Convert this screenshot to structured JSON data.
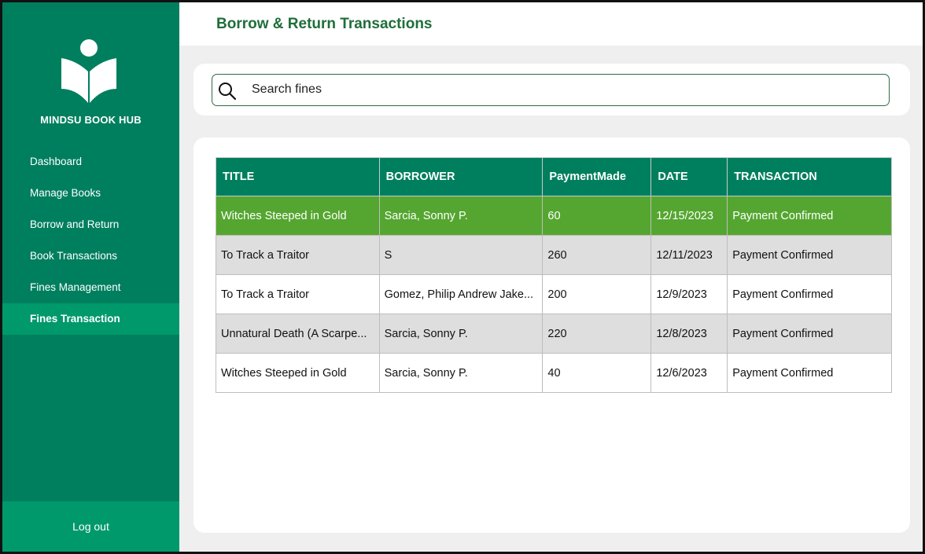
{
  "sidebar": {
    "brand": "MINDSU BOOK HUB",
    "logo_icon": "reading-book-icon",
    "items": [
      {
        "label": "Dashboard"
      },
      {
        "label": "Manage Books"
      },
      {
        "label": "Borrow and Return"
      },
      {
        "label": "Book Transactions"
      },
      {
        "label": "Fines Management"
      },
      {
        "label": "Fines Transaction"
      }
    ],
    "active_item": "Fines Transaction",
    "logout_label": "Log out"
  },
  "header": {
    "title": "Borrow & Return Transactions"
  },
  "search": {
    "placeholder": "Search fines",
    "value": "",
    "icon": "search-icon"
  },
  "table": {
    "columns": [
      "TITLE",
      "BORROWER",
      "PaymentMade",
      "DATE",
      "TRANSACTION"
    ],
    "rows": [
      [
        "Witches Steeped in Gold",
        "Sarcia, Sonny P.",
        "60",
        "12/15/2023",
        "Payment Confirmed"
      ],
      [
        "To Track a Traitor",
        "S",
        "260",
        "12/11/2023",
        "Payment Confirmed"
      ],
      [
        "To Track a Traitor",
        "Gomez, Philip Andrew Jake...",
        "200",
        "12/9/2023",
        "Payment Confirmed"
      ],
      [
        "Unnatural Death (A Scarpe...",
        "Sarcia, Sonny P.",
        "220",
        "12/8/2023",
        "Payment Confirmed"
      ],
      [
        "Witches Steeped in Gold",
        "Sarcia, Sonny P.",
        "40",
        "12/6/2023",
        "Payment Confirmed"
      ]
    ],
    "selected_row": 0
  },
  "colors": {
    "sidebar": "#007f5f",
    "sidebar_active": "#00996b",
    "title": "#1e6e3a",
    "selected_row": "#55a630",
    "alt_row": "#dedede"
  }
}
